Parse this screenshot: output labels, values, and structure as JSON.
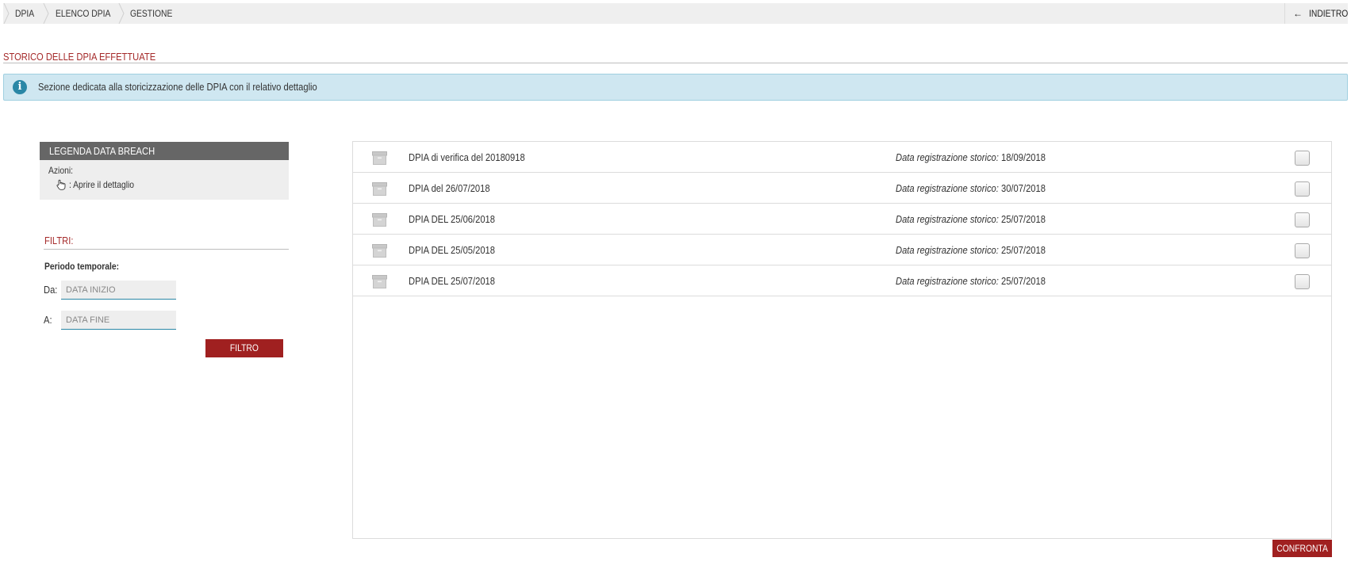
{
  "breadcrumb": {
    "items": [
      {
        "label": "DPIA"
      },
      {
        "label": "ELENCO DPIA"
      },
      {
        "label": "GESTIONE"
      }
    ],
    "back_label": "INDIETRO"
  },
  "section": {
    "title": "STORICO DELLE DPIA EFFETTUATE"
  },
  "alert": {
    "icon": "info-icon",
    "text": "Sezione dedicata alla storicizzazione delle DPIA con il relativo dettaglio"
  },
  "legend": {
    "title": "LEGENDA DATA BREACH",
    "actions_label": "Azioni:",
    "action_icon": "hand-pointer-icon",
    "action_text": ": Aprire il dettaglio"
  },
  "filters": {
    "title": "FILTRI:",
    "period_label": "Periodo temporale:",
    "from_label": "Da:",
    "from_placeholder": "DATA INIZIO",
    "to_label": "A:",
    "to_placeholder": "DATA FINE",
    "button_label": "FILTRO"
  },
  "list": {
    "date_label": "Data registrazione storico:",
    "rows": [
      {
        "name": "DPIA di verifica del 20180918",
        "date": "18/09/2018"
      },
      {
        "name": "DPIA del 26/07/2018",
        "date": "30/07/2018"
      },
      {
        "name": "DPIA DEL 25/06/2018",
        "date": "25/07/2018"
      },
      {
        "name": "DPIA DEL 25/05/2018",
        "date": "25/07/2018"
      },
      {
        "name": "DPIA DEL 25/07/2018",
        "date": "25/07/2018"
      }
    ]
  },
  "compare_button": "CONFRONTA",
  "colors": {
    "accent_red": "#a02020",
    "title_red": "#a52a2a",
    "info_bg": "#cfe7f1",
    "info_icon": "#2a87a6",
    "legend_header": "#666666"
  }
}
